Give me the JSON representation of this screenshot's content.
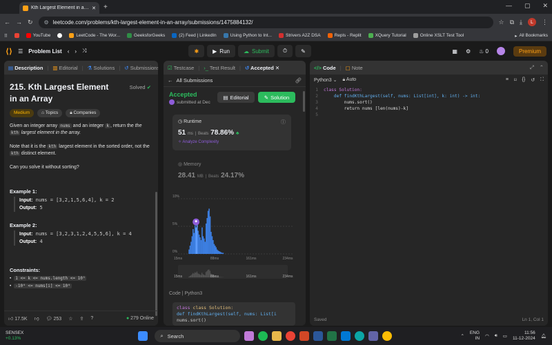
{
  "browser": {
    "tab_title": "Kth Largest Element in an Array",
    "url": "leetcode.com/problems/kth-largest-element-in-an-array/submissions/1475884132/",
    "profile_initial": "L",
    "bookmarks": [
      {
        "label": "Gmail",
        "color": "#ea4335"
      },
      {
        "label": "YouTube",
        "color": "#ff0000"
      },
      {
        "label": "LeetCode - The Wor...",
        "color": "#ffa116"
      },
      {
        "label": "GeeksforGeeks",
        "color": "#2f8d46"
      },
      {
        "label": "(2) Feed | LinkedIn",
        "color": "#0a66c2"
      },
      {
        "label": "Using Python to Int...",
        "color": "#3776ab"
      },
      {
        "label": "Strivers A2Z DSA",
        "color": "#d32f2f"
      },
      {
        "label": "Repls - Replit",
        "color": "#f26207"
      },
      {
        "label": "XQuery Tutorial",
        "color": "#4caf50"
      },
      {
        "label": "Online XSLT Test Tool",
        "color": "#9e9e9e"
      }
    ],
    "all_bookmarks": "All Bookmarks"
  },
  "nav": {
    "problem_list": "Problem List",
    "run": "Run",
    "submit": "Submit",
    "fire_count": "0",
    "premium": "Premium"
  },
  "left": {
    "tabs": [
      "Description",
      "Editorial",
      "Solutions",
      "Submissions"
    ],
    "title": "215. Kth Largest Element in an Array",
    "solved": "Solved",
    "difficulty": "Medium",
    "topics": "Topics",
    "companies": "Companies",
    "para1_a": "Given an integer array",
    "para1_nums": "nums",
    "para1_b": "and an integer",
    "para1_k": "k",
    "para1_c": ", return the",
    "para1_kth": "kth",
    "para1_d": "largest element in the array.",
    "para2_a": "Note that it is the",
    "para2_b": "largest element in the sorted order, not the",
    "para2_c": "distinct element.",
    "para3": "Can you solve it without sorting?",
    "examples": [
      {
        "title": "Example 1:",
        "input_label": "Input:",
        "input": "nums = [3,2,1,5,6,4], k = 2",
        "output_label": "Output:",
        "output": "5"
      },
      {
        "title": "Example 2:",
        "input_label": "Input:",
        "input": "nums = [3,2,3,1,2,4,5,5,6], k = 4",
        "output_label": "Output:",
        "output": "4"
      }
    ],
    "constraints_title": "Constraints:",
    "constraints": [
      "1 <= k <= nums.length <= 10⁵",
      "-10⁴ <= nums[i] <= 10⁴"
    ],
    "likes": "17.5K",
    "comments": "253",
    "online": "279 Online"
  },
  "mid": {
    "tabs": [
      "Testcase",
      "Test Result",
      "Accepted"
    ],
    "all_submissions": "All Submissions",
    "status": "Accepted",
    "submitted_at": "submitted at Dec",
    "editorial": "Editorial",
    "solution": "Solution",
    "runtime_label": "Runtime",
    "runtime_value": "51",
    "runtime_unit": "ms",
    "beats_label": "Beats",
    "runtime_beats": "78.86%",
    "analyze": "Analyze Complexity",
    "memory_label": "Memory",
    "memory_value": "28.41",
    "memory_unit": "MB",
    "memory_beats": "24.17%",
    "code_label": "Code",
    "code_lang": "Python3"
  },
  "chart_data": {
    "type": "bar",
    "title": "",
    "xlabel": "",
    "ylabel": "",
    "y_ticks": [
      "10%",
      "5%",
      "0%"
    ],
    "x_ticks": [
      "15ms",
      "88ms",
      "161ms",
      "234ms"
    ],
    "ylim": [
      0,
      10
    ],
    "xlim": [
      15,
      234
    ],
    "highlight_x": 51,
    "x": [
      36,
      38,
      40,
      42,
      44,
      46,
      48,
      50,
      52,
      54,
      56,
      58,
      60,
      62,
      64,
      66,
      68,
      70,
      72,
      74,
      76,
      78,
      80,
      82,
      84,
      86,
      88,
      90,
      92,
      94,
      96,
      98,
      100,
      102,
      104
    ],
    "values": [
      0.8,
      1.5,
      2.2,
      3.2,
      4.5,
      3.8,
      5.2,
      4.8,
      6.0,
      4.2,
      3.5,
      3.0,
      2.5,
      4.8,
      3.2,
      2.8,
      2.2,
      5.5,
      6.5,
      7.8,
      8.2,
      6.8,
      4.0,
      3.2,
      2.5,
      1.8,
      1.5,
      1.2,
      0.8,
      0.6,
      0.5,
      0.4,
      0.3,
      0.2,
      0.2
    ]
  },
  "mid_code": [
    "class Solution:",
    "    def findKthLargest(self, nums: List[i",
    "        nums.sort()"
  ],
  "right": {
    "tab_code": "Code",
    "tab_note": "Note",
    "lang": "Python3",
    "auto": "Auto",
    "lines": [
      "class Solution:",
      "    def findKthLargest(self, nums: List[int], k: int) -> int:",
      "        nums.sort()",
      "        return nums [len(nums)-k]",
      ""
    ],
    "saved": "Saved",
    "position": "Ln 1, Col 1"
  },
  "taskbar": {
    "ticker": "SENSEX",
    "change": "+0.13%",
    "search": "Search",
    "lang1": "ENG",
    "lang2": "IN",
    "time": "11:56",
    "date": "11-12-2024"
  }
}
